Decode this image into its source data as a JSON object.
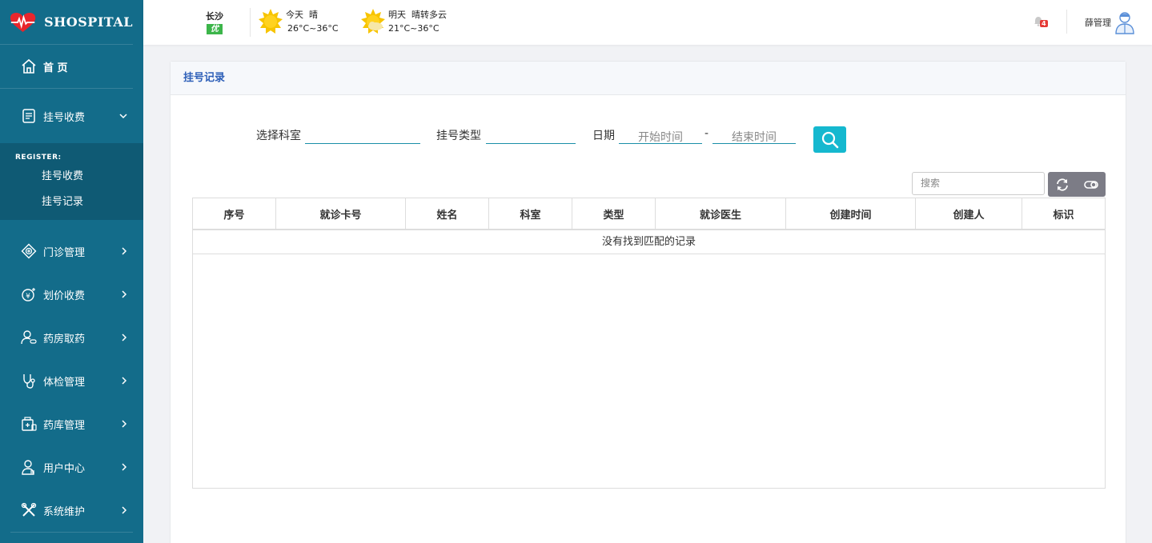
{
  "brand": {
    "name": "SHOSPITAL"
  },
  "sidebar": {
    "home": {
      "label": "首 页"
    },
    "register": {
      "label": "挂号收费"
    },
    "submenu": {
      "title": "REGISTER:",
      "items": [
        {
          "label": "挂号收费"
        },
        {
          "label": "挂号记录"
        }
      ]
    },
    "items": [
      {
        "label": "门诊管理",
        "icon": "clinic-icon"
      },
      {
        "label": "划价收费",
        "icon": "yuan-icon"
      },
      {
        "label": "药房取药",
        "icon": "pharmacy-icon"
      },
      {
        "label": "体检管理",
        "icon": "stethoscope-icon"
      },
      {
        "label": "药库管理",
        "icon": "medicine-store-icon"
      },
      {
        "label": "用户中心",
        "icon": "user-icon"
      },
      {
        "label": "系统维护",
        "icon": "tools-icon"
      }
    ]
  },
  "topbar": {
    "city": "长沙",
    "aqi": "优",
    "today": {
      "label": "今天",
      "cond": "晴",
      "temp": "26°C~36°C"
    },
    "tomorrow": {
      "label": "明天",
      "cond": "晴转多云",
      "temp": "21°C~36°C"
    },
    "notifications": "4",
    "user": "薛管理"
  },
  "panel": {
    "title": "挂号记录",
    "filters": {
      "department_label": "选择科室",
      "type_label": "挂号类型",
      "date_label": "日期",
      "start_placeholder": "开始时间",
      "dash": "-",
      "end_placeholder": "结束时间"
    },
    "toolbar": {
      "search_placeholder": "搜索"
    },
    "table": {
      "columns": [
        "序号",
        "就诊卡号",
        "姓名",
        "科室",
        "类型",
        "就诊医生",
        "创建时间",
        "创建人",
        "标识"
      ],
      "empty_text": "没有找到匹配的记录"
    }
  },
  "colors": {
    "sidebar": "#136c8a",
    "submenu": "#0f5a74",
    "accent": "#15b8cf",
    "title": "#2d5fb8",
    "badge": "#e53935"
  }
}
